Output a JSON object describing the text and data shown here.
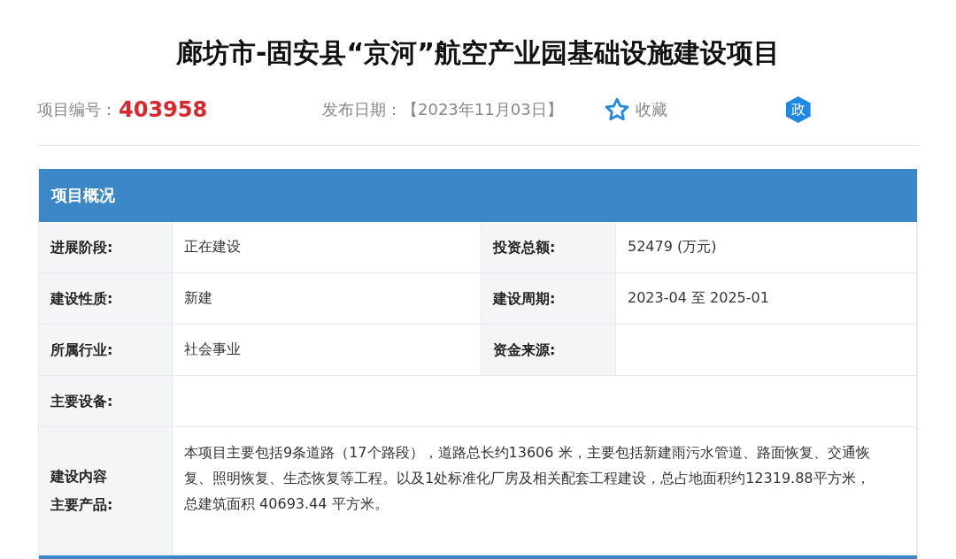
{
  "title": "廊坊市-固安县“京河”航空产业园基础设施建设项目",
  "meta": {
    "id_label": "项目编号：",
    "id_value": "403958",
    "date_label": "发布日期：",
    "date_value": "【2023年11月03日】",
    "favorite": {
      "label": "收藏",
      "selected": false
    },
    "badge": "政"
  },
  "table": {
    "heading": "项目概况",
    "rows": [
      {
        "kind": "pair",
        "cells": [
          {
            "label": "进展阶段:",
            "value": "正在建设"
          },
          {
            "label": "投资总额:",
            "value": "52479 (万元)"
          }
        ]
      },
      {
        "kind": "pair",
        "cells": [
          {
            "label": "建设性质:",
            "value": "新建"
          },
          {
            "label": "建设周期:",
            "value": "2023-04 至 2025-01"
          }
        ]
      },
      {
        "kind": "pair",
        "cells": [
          {
            "label": "所属行业:",
            "value": "社会事业"
          },
          {
            "label": "资金来源:"
          }
        ]
      },
      {
        "kind": "full",
        "cells": [
          {
            "label": "主要设备:"
          }
        ]
      },
      {
        "kind": "tall",
        "cells": [
          {
            "label_lines": [
              "建设内容",
              "主要产品:"
            ],
            "value": "本项目主要包括9条道路（17个路段），道路总长约13606 米，主要包括新建雨污水管道、路面恢复、交通恢复、照明恢复、生态恢复等工程。以及1处标准化厂房及相关配套工程建设，总占地面积约12319.88平方米，总建筑面积 40693.44 平方米。"
          }
        ]
      }
    ]
  }
}
